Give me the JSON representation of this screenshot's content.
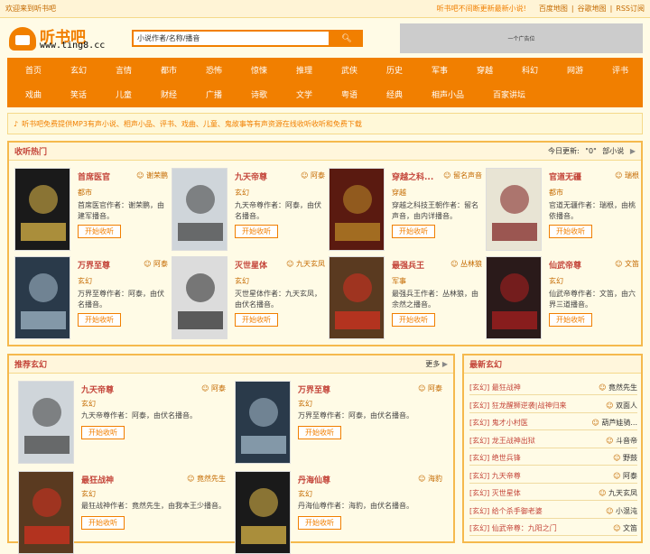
{
  "topbar": {
    "welcome": "欢迎来到听书吧",
    "notice": "听书吧不间断更新最新小说!",
    "links": [
      "百度地图",
      "谷歌地图",
      "RSS订阅"
    ]
  },
  "header": {
    "logo_cn": "听书吧",
    "logo_url": "www.ting8.cc",
    "search_placeholder": "小说作者/名称/播音",
    "ad_text": "一个广告位"
  },
  "nav": {
    "row1": [
      "首页",
      "玄幻",
      "言情",
      "都市",
      "恐怖",
      "惊悚",
      "推理",
      "武侠",
      "历史",
      "军事",
      "穿越",
      "科幻",
      "网游",
      "评书"
    ],
    "row2": [
      "戏曲",
      "笑话",
      "儿童",
      "财经",
      "广播",
      "诗歌",
      "文学",
      "粤语",
      "经典",
      "相声小品",
      "百家讲坛"
    ]
  },
  "infobar": "听书吧免费提供MP3有声小说、相声小品、评书、戏曲、儿童、鬼故事等有声资源在线收听收听和免费下载",
  "hot": {
    "title": "收听热门",
    "today_label": "今日更新:",
    "today_count": "\"0\"",
    "today_unit": "部小说",
    "books": [
      {
        "title": "首席医官",
        "author": "谢荣鹏",
        "cat": "都市",
        "desc": "首席医官作者：谢荣鹏，由建军播音。",
        "btn": "开始收听"
      },
      {
        "title": "九天帝尊",
        "author": "阿泰",
        "cat": "玄幻",
        "desc": "九天帝尊作者：阿泰，由伏名播音。",
        "btn": "开始收听"
      },
      {
        "title": "穿越之科...",
        "author": "留名声音",
        "cat": "穿越",
        "desc": "穿越之科技王朝作者：留名声音，由内详播音。",
        "btn": "开始收听"
      },
      {
        "title": "官道无疆",
        "author": "瑞根",
        "cat": "都市",
        "desc": "官道无疆作者：瑞根，由桃依播音。",
        "btn": "开始收听"
      },
      {
        "title": "万界至尊",
        "author": "阿泰",
        "cat": "玄幻",
        "desc": "万界至尊作者：阿泰，由伏名播音。",
        "btn": "开始收听"
      },
      {
        "title": "灭世星体",
        "author": "九天玄凤",
        "cat": "玄幻",
        "desc": "灭世星体作者：九天玄凤，由伏名播音。",
        "btn": "开始收听"
      },
      {
        "title": "最强兵王",
        "author": "丛林狼",
        "cat": "军事",
        "desc": "最强兵王作者：丛林狼，由余然之播音。",
        "btn": "开始收听"
      },
      {
        "title": "仙武帝尊",
        "author": "文笛",
        "cat": "玄幻",
        "desc": "仙武帝尊作者：文笛，由六界三道播音。",
        "btn": "开始收听"
      }
    ]
  },
  "recommend": {
    "title": "推荐玄幻",
    "more": "更多",
    "books": [
      {
        "title": "九天帝尊",
        "author": "阿泰",
        "cat": "玄幻",
        "desc": "九天帝尊作者：阿泰，由伏名播音。",
        "btn": "开始收听"
      },
      {
        "title": "万界至尊",
        "author": "阿泰",
        "cat": "玄幻",
        "desc": "万界至尊作者：阿泰，由伏名播音。",
        "btn": "开始收听"
      },
      {
        "title": "最狂战神",
        "author": "竟然先生",
        "cat": "玄幻",
        "desc": "最狂战神作者：竟然先生，由我本王少播音。",
        "btn": "开始收听"
      },
      {
        "title": "丹海仙尊",
        "author": "海豹",
        "cat": "玄幻",
        "desc": "丹海仙尊作者：海豹，由伏名播音。",
        "btn": "开始收听"
      }
    ]
  },
  "latest": {
    "title": "最新玄幻",
    "items": [
      {
        "name": "[玄幻] 最狂战神",
        "author": "竟然先生"
      },
      {
        "name": "[玄幻] 狂龙醒狮逆袭|战神归来",
        "author": "双面人"
      },
      {
        "name": "[玄幻] 鬼才小村医",
        "author": "葫芦娃骑..."
      },
      {
        "name": "[玄幻] 龙王战神出狱",
        "author": "斗音帝"
      },
      {
        "name": "[玄幻] 绝世兵锋",
        "author": "野鼓"
      },
      {
        "name": "[玄幻] 九天帝尊",
        "author": "阿泰"
      },
      {
        "name": "[玄幻] 灭世星体",
        "author": "九天玄凤"
      },
      {
        "name": "[玄幻] 给个杀手御老婆",
        "author": "小混沌"
      },
      {
        "name": "[玄幻] 仙武帝尊：九阳之门",
        "author": "文笛"
      }
    ]
  }
}
